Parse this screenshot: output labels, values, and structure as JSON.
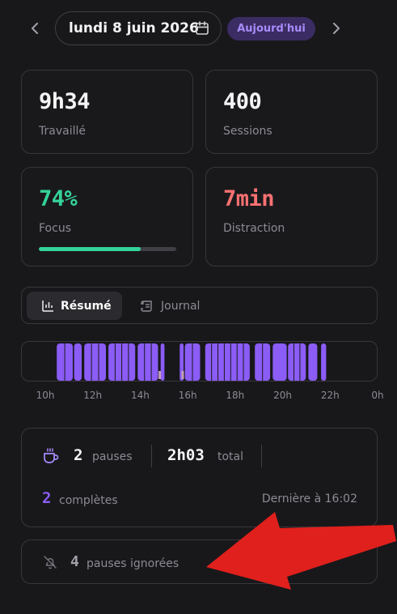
{
  "header": {
    "prev_icon": "chevron-left-icon",
    "date_label": "lundi 8 juin 2026",
    "calendar_icon": "calendar-icon",
    "today_label": "Aujourd'hui",
    "next_icon": "chevron-right-icon",
    "colors": {
      "today_bg": "#3b2c63",
      "today_fg": "#a78bfa"
    }
  },
  "stats": {
    "worked": {
      "value": "9h34",
      "label": "Travaillé"
    },
    "sessions": {
      "value": "400",
      "label": "Sessions"
    },
    "focus": {
      "value": "74%",
      "label": "Focus",
      "progress": 0.74,
      "color": "#34d399"
    },
    "distraction": {
      "value": "7min",
      "label": "Distraction",
      "color": "#f87171"
    }
  },
  "tabs": [
    {
      "label": "Résumé",
      "icon": "bar-chart-icon",
      "active": true
    },
    {
      "label": "Journal",
      "icon": "scroll-icon",
      "active": false
    }
  ],
  "timeline": {
    "axis_labels": [
      "10h",
      "12h",
      "14h",
      "16h",
      "18h",
      "20h",
      "22h",
      "0h"
    ],
    "range_hours": [
      10,
      24
    ],
    "colors": {
      "activity": "#8b5cf6",
      "gap": "#2a2a2f",
      "pause": "#c4a0b8"
    },
    "blocks": [
      [
        11.37,
        12.0
      ],
      [
        12.05,
        12.35
      ],
      [
        12.45,
        13.3
      ],
      [
        13.4,
        14.45
      ],
      [
        14.55,
        15.35
      ],
      [
        15.45,
        15.6
      ],
      [
        16.2,
        16.35
      ],
      [
        16.4,
        17.0
      ],
      [
        17.2,
        18.95
      ],
      [
        19.15,
        19.75
      ],
      [
        19.85,
        20.4
      ],
      [
        20.45,
        21.15
      ],
      [
        21.25,
        21.6
      ],
      [
        21.75,
        21.95
      ]
    ],
    "pause_marks": [
      15.4,
      16.3
    ]
  },
  "pauses": {
    "icon": "coffee-icon",
    "count": "2",
    "count_label": "pauses",
    "total": "2h03",
    "total_label": "total",
    "complete_count": "2",
    "complete_label": "complètes",
    "last_label": "Dernière à 16:02"
  },
  "ignored": {
    "icon": "bell-off-icon",
    "count": "4",
    "label": "pauses ignorées"
  },
  "annotation": {
    "arrow_color": "#e0201c",
    "icon": "red-arrow-icon"
  }
}
